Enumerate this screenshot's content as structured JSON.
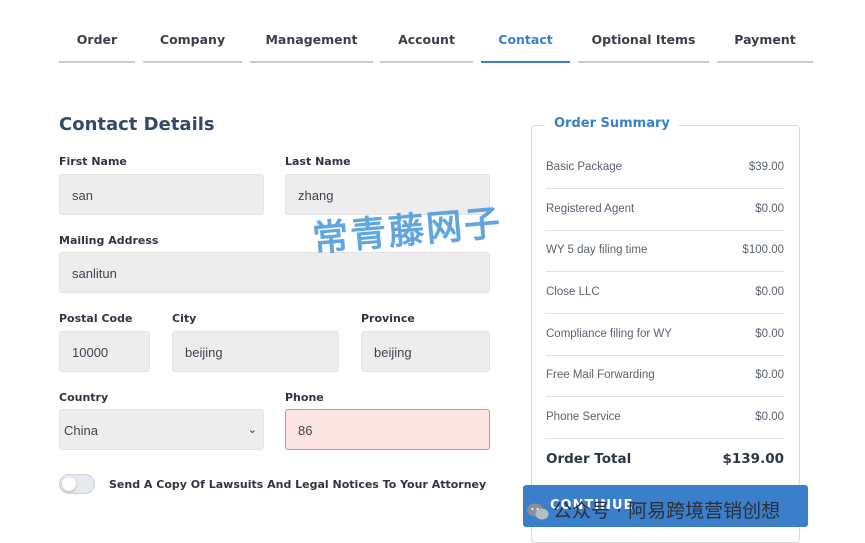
{
  "tabs": [
    {
      "label": "Order"
    },
    {
      "label": "Company"
    },
    {
      "label": "Management"
    },
    {
      "label": "Account"
    },
    {
      "label": "Contact"
    },
    {
      "label": "Optional Items"
    },
    {
      "label": "Payment"
    }
  ],
  "active_tab": "Contact",
  "form": {
    "title": "Contact Details",
    "first_name": {
      "label": "First Name",
      "value": "san"
    },
    "last_name": {
      "label": "Last Name",
      "value": "zhang"
    },
    "mailing_address": {
      "label": "Mailing Address",
      "value": "sanlitun"
    },
    "postal_code": {
      "label": "Postal Code",
      "value": "10000"
    },
    "city": {
      "label": "City",
      "value": "beijing"
    },
    "province": {
      "label": "Province",
      "value": "beijing"
    },
    "country": {
      "label": "Country",
      "value": "China"
    },
    "phone": {
      "label": "Phone",
      "value": "86"
    },
    "attorney_toggle": {
      "label": "Send A Copy Of Lawsuits And Legal Notices To Your Attorney",
      "checked": false
    }
  },
  "summary": {
    "title": "Order Summary",
    "items": [
      {
        "name": "Basic Package",
        "price": "$39.00"
      },
      {
        "name": "Registered Agent",
        "price": "$0.00"
      },
      {
        "name": "WY 5 day filing time",
        "price": "$100.00"
      },
      {
        "name": "Close LLC",
        "price": "$0.00"
      },
      {
        "name": "Compliance filing for WY",
        "price": "$0.00"
      },
      {
        "name": "Free Mail Forwarding",
        "price": "$0.00"
      },
      {
        "name": "Phone Service",
        "price": "$0.00"
      }
    ],
    "total_label": "Order Total",
    "total_value": "$139.00",
    "continue_label": "CONTINUE"
  },
  "watermark": "常青藤网子",
  "footer_watermark": "公众号 · 阿易跨境营销创想",
  "colors": {
    "accent": "#3b7fcb",
    "error_bg": "#fbe4e1",
    "field_bg": "#ededed"
  }
}
